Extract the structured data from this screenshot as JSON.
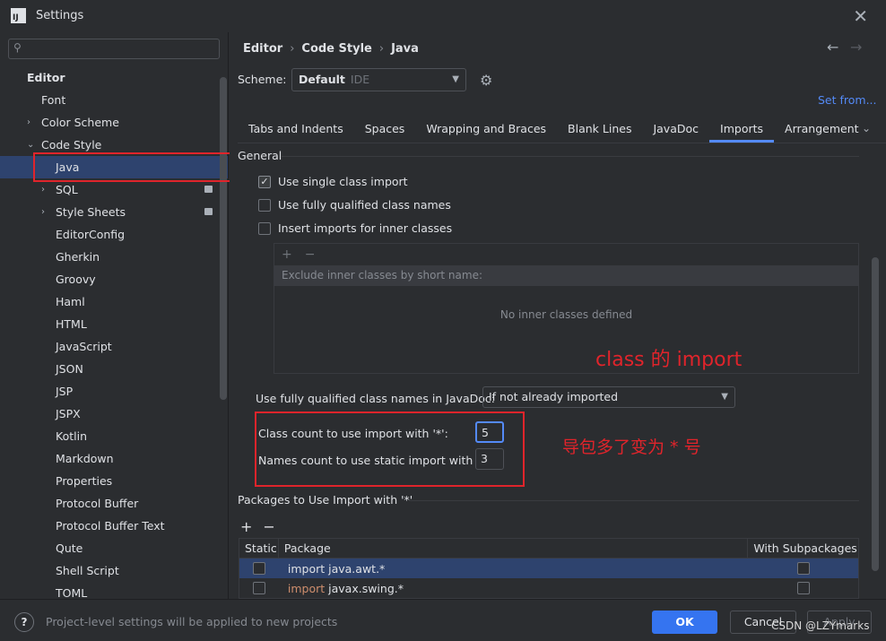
{
  "window": {
    "title": "Settings",
    "logo": "IJ"
  },
  "sidebar": {
    "search_placeholder": "",
    "items": [
      {
        "label": "Editor",
        "level": 0,
        "bold": true
      },
      {
        "label": "Font",
        "level": 1
      },
      {
        "label": "Color Scheme",
        "level": 1,
        "chevron": "›"
      },
      {
        "label": "Code Style",
        "level": 1,
        "chevron": "⌄"
      },
      {
        "label": "Java",
        "level": 2,
        "selected": true
      },
      {
        "label": "SQL",
        "level": 2,
        "chevron": "›",
        "badge": true
      },
      {
        "label": "Style Sheets",
        "level": 2,
        "chevron": "›",
        "badge": true
      },
      {
        "label": "EditorConfig",
        "level": 2
      },
      {
        "label": "Gherkin",
        "level": 2
      },
      {
        "label": "Groovy",
        "level": 2
      },
      {
        "label": "Haml",
        "level": 2
      },
      {
        "label": "HTML",
        "level": 2
      },
      {
        "label": "JavaScript",
        "level": 2
      },
      {
        "label": "JSON",
        "level": 2
      },
      {
        "label": "JSP",
        "level": 2
      },
      {
        "label": "JSPX",
        "level": 2
      },
      {
        "label": "Kotlin",
        "level": 2
      },
      {
        "label": "Markdown",
        "level": 2
      },
      {
        "label": "Properties",
        "level": 2
      },
      {
        "label": "Protocol Buffer",
        "level": 2
      },
      {
        "label": "Protocol Buffer Text",
        "level": 2
      },
      {
        "label": "Qute",
        "level": 2
      },
      {
        "label": "Shell Script",
        "level": 2
      },
      {
        "label": "TOML",
        "level": 2
      }
    ]
  },
  "breadcrumb": {
    "items": [
      "Editor",
      "Code Style",
      "Java"
    ],
    "sep": "›"
  },
  "scheme": {
    "label": "Scheme:",
    "value": "Default",
    "sub": "IDE",
    "set_from": "Set from..."
  },
  "tabs": [
    {
      "label": "Tabs and Indents"
    },
    {
      "label": "Spaces"
    },
    {
      "label": "Wrapping and Braces"
    },
    {
      "label": "Blank Lines"
    },
    {
      "label": "JavaDoc"
    },
    {
      "label": "Imports",
      "active": true
    },
    {
      "label": "Arrangement"
    }
  ],
  "general": {
    "title": "General",
    "use_single_class_import": "Use single class import",
    "use_fully_qualified": "Use fully qualified class names",
    "insert_inner": "Insert imports for inner classes",
    "exclude_header": "Exclude inner classes by short name:",
    "empty_text": "No inner classes defined",
    "plus": "+",
    "minus": "−"
  },
  "javadoc": {
    "label": "Use fully qualified class names in JavaDoc:",
    "value": "If not already imported"
  },
  "counts": {
    "class_label": "Class count to use import with '*':",
    "class_value": "5",
    "names_label": "Names count to use static import with '*':",
    "names_value": "3"
  },
  "packages": {
    "title": "Packages to Use Import with '*'",
    "col_static": "Static",
    "col_package": "Package",
    "col_sub": "With Subpackages",
    "rows": [
      {
        "kw": "",
        "text": "import java.awt.*"
      },
      {
        "kw": "import",
        "text": " javax.swing.*"
      }
    ]
  },
  "annotations": {
    "class_import": "class 的 import",
    "pkg_star": "导包多了变为 * 号"
  },
  "footer": {
    "help": "?",
    "note": "Project-level settings will be applied to new projects",
    "ok": "OK",
    "cancel": "Cancel",
    "apply": "Apply",
    "watermark": "CSDN @LZYmarks"
  }
}
